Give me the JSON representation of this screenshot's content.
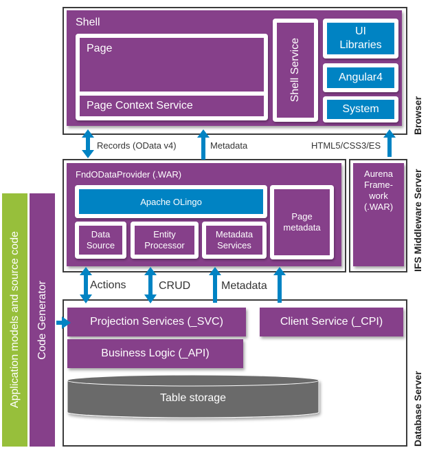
{
  "browser": {
    "tier_label": "Browser",
    "shell": {
      "title": "Shell"
    },
    "page": {
      "title": "Page"
    },
    "page_context_service": "Page Context Service",
    "shell_service": "Shell Service",
    "ui_libraries": "UI Libraries",
    "angular": "Angular4",
    "system": "System"
  },
  "connectors_top": {
    "records": "Records (OData v4)",
    "metadata": "Metadata",
    "html5": "HTML5/CSS3/ES"
  },
  "middleware": {
    "tier_label": "IFS Middleware Server",
    "provider": {
      "title": "FndODataProvider (.WAR)"
    },
    "olingo": "Apache OLingo",
    "data_source": "Data Source",
    "entity_processor": "Entity Processor",
    "metadata_services": "Metadata Services",
    "page_metadata": "Page metadata",
    "aurena_framework": "Aurena Frame-work (.WAR)"
  },
  "connectors_bottom": {
    "actions": "Actions",
    "crud": "CRUD",
    "metadata": "Metadata"
  },
  "database": {
    "tier_label": "Database Server",
    "projection_services": "Projection Services (_SVC)",
    "client_service": "Client Service (_CPI)",
    "business_logic": "Business Logic (_API)",
    "table_storage": "Table storage"
  },
  "left": {
    "app_models": "Application models and source code",
    "code_generator": "Code Generator"
  },
  "colors": {
    "purple": "#86408a",
    "blue": "#0083c3",
    "green": "#97bf3b",
    "storage_gray": "#6b6b6b",
    "arrow_blue": "#0083c3"
  }
}
